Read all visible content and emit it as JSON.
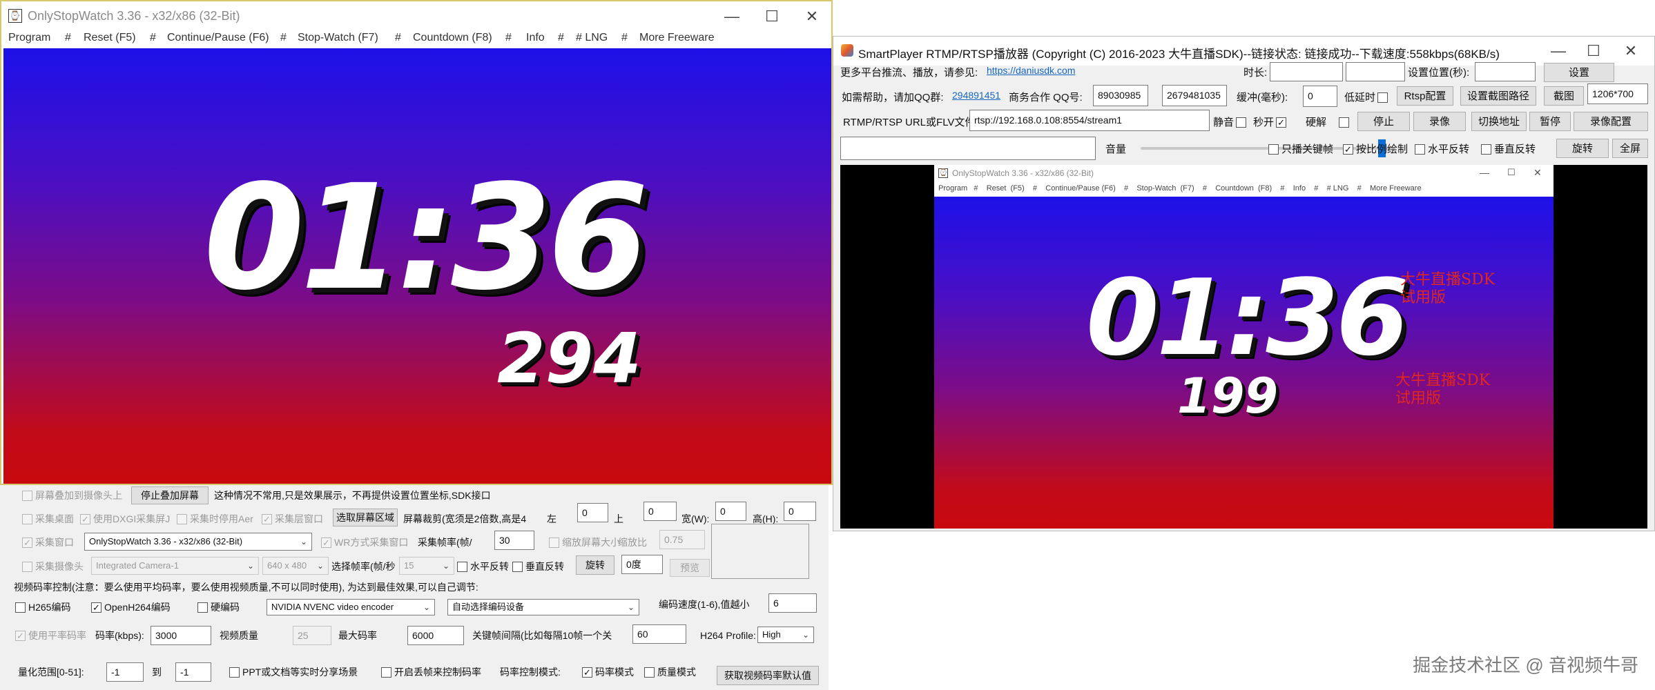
{
  "left_window": {
    "title": "OnlyStopWatch 3.36 - x32/x86 (32-Bit)",
    "menu": [
      "Program",
      "#",
      "Reset  (F5)",
      "#",
      "Continue/Pause (F6)",
      "#",
      "Stop-Watch  (F7)",
      "#",
      "Countdown  (F8)",
      "#",
      "Info",
      "#",
      "# LNG",
      "#",
      "More Freeware"
    ],
    "time": "01:36",
    "ms": "294",
    "controls": {
      "minimize": "—",
      "maximize": "☐",
      "close": "✕"
    }
  },
  "panel": {
    "overlay_cb": "屏幕叠加到摄像头上",
    "stop_overlay_btn": "停止叠加屏幕",
    "overlay_note": "这种情况不常用,只是效果展示，不再提供设置位置坐标,SDK接口",
    "capture_desktop_cb": "采集桌面",
    "dxgi_cb": "使用DXGI采集屏J",
    "aero_cb": "采集时停用Aer",
    "layered_cb": "采集层窗口",
    "select_area_btn": "选取屏幕区域",
    "crop_note": "屏幕裁剪(宽须是2倍数,高是4",
    "left_label": "左",
    "left_val": "0",
    "top_label": "上",
    "top_val": "0",
    "width_label": "宽(W):",
    "width_val": "0",
    "height_label": "高(H):",
    "height_val": "0",
    "capture_window_cb": "采集窗口",
    "window_select": "OnlyStopWatch 3.36 - x32/x86 (32-Bit)",
    "wr_cb": "WR方式采集窗口",
    "fps_label": "采集帧率(帧/",
    "fps_val": "30",
    "scale_cb": "缩放屏幕大小",
    "scale_label": "缩放比",
    "scale_val": "0.75",
    "capture_camera_cb": "采集摄像头",
    "camera_select": "Integrated Camera-1",
    "camera_res_select": "640 x 480",
    "camera_fps_label": "选择帧率(帧/秒",
    "camera_fps_select": "15",
    "hflip_cb": "水平反转",
    "vflip_cb": "垂直反转",
    "rotate_btn": "旋转",
    "rotate_val": "0度",
    "preview_btn": "预览",
    "bitrate_note": "视频码率控制(注意：要么使用平均码率，要么使用视频质量,不可以同时使用), 为达到最佳效果,可以自己调节:",
    "h265_cb": "H265编码",
    "openh264_cb": "OpenH264编码",
    "hw_cb": "硬编码",
    "encoder_select": "NVIDIA NVENC video encoder",
    "device_select": "自动选择编码设备",
    "speed_label": "编码速度(1-6),值越小",
    "speed_val": "6",
    "avg_bitrate_cb": "使用平率码率",
    "bitrate_label": "码率(kbps):",
    "bitrate_val": "3000",
    "quality_label": "视频质量",
    "quality_val": "25",
    "max_bitrate_label": "最大码率",
    "max_bitrate_val": "6000",
    "keyframe_label": "关键帧间隔(比如每隔10帧一个关",
    "keyframe_val": "60",
    "profile_label": "H264 Profile:",
    "profile_select": "High",
    "qp_label": "量化范围[0-51]:",
    "qp_min": "-1",
    "qp_to": "到",
    "qp_max": "-1",
    "ppt_cb": "PPT或文档等实时分享场景",
    "drop_cb": "开启丢帧来控制码率",
    "rc_mode_label": "码率控制模式:",
    "bitrate_mode_cb": "码率模式",
    "quality_mode_cb": "质量模式",
    "get_default_btn": "获取视频码率默认值"
  },
  "right_window": {
    "title": "SmartPlayer RTMP/RTSP播放器 (Copyright (C) 2016-2023 大牛直播SDK)--链接状态: 链接成功--下载速度:558kbps(68KB/s)",
    "more_label": "更多平台推流、播放，请参见:",
    "more_link": "https://daniusdk.com",
    "duration_label": "时长:",
    "set_pos_label": "设置位置(秒):",
    "set_btn": "设置",
    "help_label": "如需帮助，请加QQ群:",
    "qq_group": "294891451",
    "biz_label": "商务合作 QQ号:",
    "qq1": "89030985",
    "qq2": "2679481035",
    "buffer_label": "缓冲(毫秒):",
    "buffer_val": "0",
    "low_latency": "低延时",
    "rtsp_cfg_btn": "Rtsp配置",
    "snap_path_btn": "设置截图路径",
    "snap_btn": "截图",
    "resolution": "1206*700",
    "url_label": "RTMP/RTSP URL或FLV文件",
    "url_val": "rtsp://192.168.0.108:8554/stream1",
    "mute": "静音",
    "instant": "秒开",
    "hw_decode": "硬解",
    "stop_btn": "停止",
    "record_btn": "录像",
    "switch_btn": "切换地址",
    "pause_btn": "暂停",
    "record_cfg_btn": "录像配置",
    "volume_label": "音量",
    "volume_level": 0.95,
    "keyframe_only": "只播关键帧",
    "ratio_draw": "按比例绘制",
    "hflip": "水平反转",
    "vflip": "垂直反转",
    "rotate_btn": "旋转",
    "fullscreen_btn": "全屏",
    "video_title": "OnlyStopWatch 3.36 - x32/x86 (32-Bit)",
    "video_menu": "Program   #    Reset  (F5)    #    Continue/Pause (F6)    #    Stop-Watch  (F7)    #    Countdown  (F8)    #    Info    #    # LNG    #    More Freeware",
    "video_time": "01:36",
    "video_ms": "199",
    "watermark_line1": "大牛直播SDK",
    "watermark_line2": "试用版"
  },
  "footer": {
    "watermark": "掘金技术社区 @ 音视频牛哥"
  }
}
